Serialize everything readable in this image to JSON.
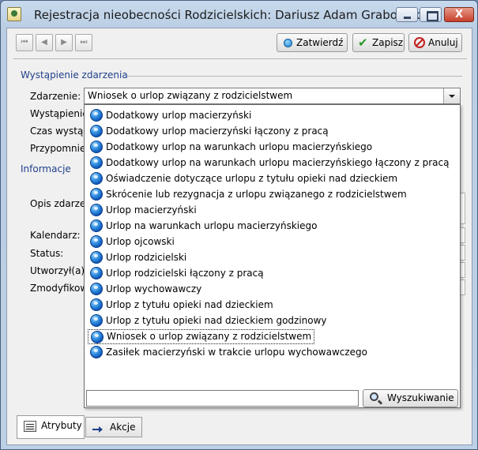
{
  "window": {
    "title": "Rejestracja nieobecności Rodzicielskich:  Dariusz Adam Grabowski",
    "close_glyph": "X"
  },
  "toolbar": {
    "nav_first": "⏮",
    "nav_prev": "◀",
    "nav_next": "▶",
    "nav_last": "⏭",
    "confirm_label": "Zatwierdź",
    "save_label": "Zapisz",
    "cancel_label": "Anuluj"
  },
  "form": {
    "section_event": "Wystąpienie zdarzenia",
    "section_info": "Informacje",
    "labels": {
      "event": "Zdarzenie:",
      "occurrence": "Wystąpienie",
      "time": "Czas wystąpi",
      "reminder": "Przypomnien",
      "description": "Opis zdarzen",
      "calendar": "Kalendarz:",
      "status": "Status:",
      "created_by": "Utworzył(a):",
      "modified_by": "Zmodyfikow"
    },
    "event_value": "Wniosek o urlop związany z rodzicielstwem"
  },
  "dropdown": {
    "options": [
      "Dodatkowy urlop macierzyński",
      "Dodatkowy urlop macierzyński łączony z pracą",
      "Dodatkowy urlop na warunkach urlopu macierzyńskiego",
      "Dodatkowy urlop na warunkach urlopu macierzyńskiego łączony z pracą",
      "Oświadczenie dotyczące urlopu z tytułu opieki nad dzieckiem",
      "Skrócenie lub rezygnacja z urlopu związanego z rodzicielstwem",
      "Urlop macierzyński",
      "Urlop na warunkach urlopu macierzyńskiego",
      "Urlop ojcowski",
      "Urlop rodzicielski",
      "Urlop rodzicielski łączony z pracą",
      "Urlop wychowawczy",
      "Urlop z tytułu opieki nad dzieckiem",
      "Urlop z tytułu opieki nad dzieckiem godzinowy",
      "Wniosek o urlop związany z rodzicielstwem",
      "Zasiłek macierzyński w trakcie urlopu wychowawczego"
    ],
    "selected": "Wniosek o urlop związany z rodzicielstwem",
    "search_value": "",
    "search_label": "Wyszukiwanie"
  },
  "tabs": {
    "attributes": "Atrybuty",
    "actions": "Akcje"
  }
}
